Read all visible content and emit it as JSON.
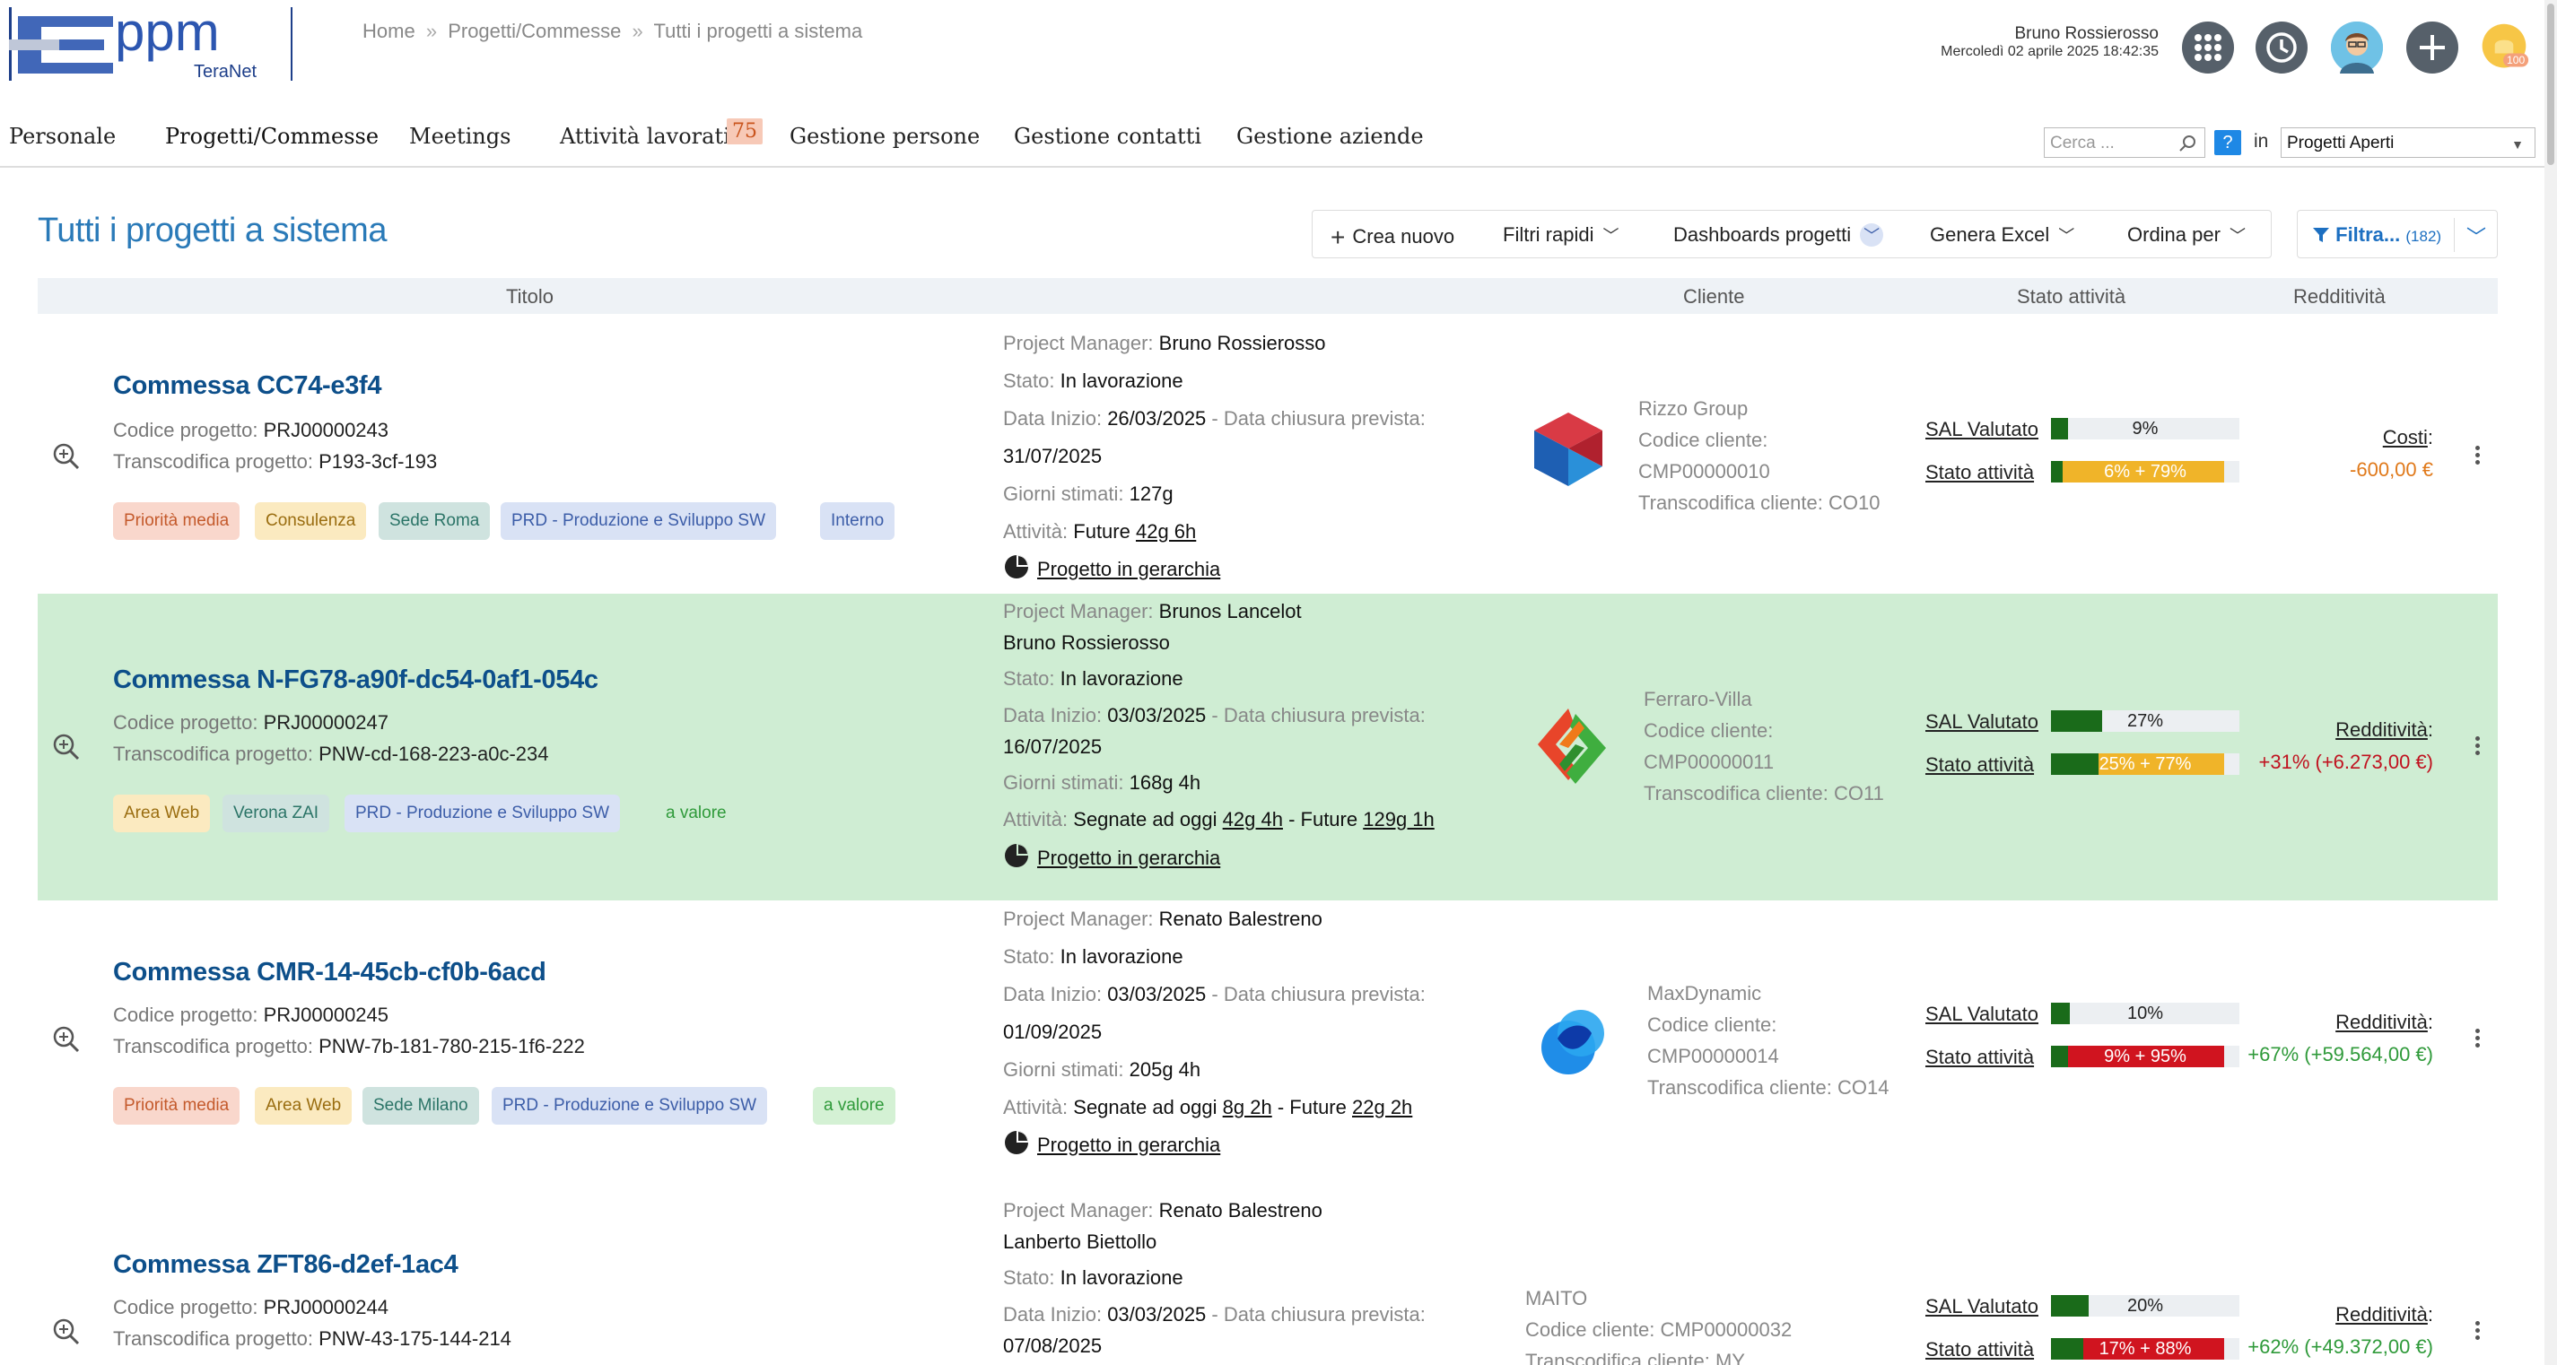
{
  "brand": {
    "name": "ppm",
    "sub": "TeraNet"
  },
  "breadcrumb": {
    "home": "Home",
    "sep1": "»",
    "section": "Progetti/Commesse",
    "sep2": "»",
    "current": "Tutti i progetti a sistema"
  },
  "user": {
    "name": "Bruno Rossierosso",
    "date": "Mercoledì 02 aprile 2025 18:42:35",
    "notifications": "100"
  },
  "nav": {
    "items": [
      "Personale",
      "Progetti/Commesse",
      "Meetings",
      "Attività lavorative",
      "Gestione persone",
      "Gestione contatti",
      "Gestione aziende"
    ],
    "badge": "75",
    "search_placeholder": "Cerca ...",
    "help": "?",
    "in_label": "in",
    "scope_value": "Progetti Aperti"
  },
  "page": {
    "title": "Tutti i progetti a sistema"
  },
  "toolbar": {
    "create": "Crea nuovo",
    "quick_filters": "Filtri rapidi",
    "dashboards": "Dashboards progetti",
    "excel": "Genera Excel",
    "order": "Ordina per",
    "filter": "Filtra...",
    "filter_count": "(182)"
  },
  "table": {
    "col_title": "Titolo",
    "col_client": "Cliente",
    "col_status": "Stato attività",
    "col_profit": "Redditività"
  },
  "labels": {
    "code": "Codice progetto",
    "transcode": "Transcodifica progetto",
    "pm": "Project Manager:",
    "state": "Stato:",
    "start": "Data Inizio:",
    "end": "- Data chiusura prevista:",
    "days": "Giorni stimati:",
    "activities": "Attività:",
    "hierarchy": "Progetto in gerarchia",
    "client_code": "Codice cliente:",
    "client_transcode": "Transcodifica cliente:",
    "sal": "SAL Valutato",
    "stato_att": "Stato attività"
  },
  "rows": [
    {
      "title": "Commessa CC74-e3f4",
      "code": "PRJ00000243",
      "transcode": "P193-3cf-193",
      "tags": [
        "Priorità media",
        "Consulenza",
        "Sede Roma",
        "PRD - Produzione e Sviluppo SW",
        "Interno"
      ],
      "pm": "Bruno Rossierosso",
      "state": "In lavorazione",
      "start": "26/03/2025",
      "end": "31/07/2025",
      "days": "127g",
      "act_prefix": "Future",
      "act_value": "42g 6h",
      "client_name": "Rizzo Group",
      "client_code": "CMP00000010",
      "client_transcode": "CO10",
      "sal": "9%",
      "sal_pct": 0.09,
      "att": "6% + 79%",
      "att_done_pct": 0.06,
      "att_color": "#f0b429",
      "profit_label": "Costi",
      "profit_value": "-600,00 €"
    },
    {
      "title": "Commessa N-FG78-a90f-dc54-0af1-054c",
      "code": "PRJ00000247",
      "transcode": "PNW-cd-168-223-a0c-234",
      "tags": [
        "Area Web",
        "Verona ZAI",
        "PRD - Produzione e Sviluppo SW",
        "a valore"
      ],
      "pm": "Brunos Lancelot",
      "pm2": "Bruno Rossierosso",
      "state": "In lavorazione",
      "start": "03/03/2025",
      "end": "16/07/2025",
      "days": "168g 4h",
      "act_prefix": "Segnate ad oggi",
      "act_value": "42g 4h",
      "act_future_label": "- Future",
      "act_future": "129g 1h",
      "client_name": "Ferraro-Villa",
      "client_code": "CMP00000011",
      "client_transcode": "CO11",
      "sal": "27%",
      "sal_pct": 0.27,
      "att": "25% + 77%",
      "att_done_pct": 0.25,
      "att_color": "#f0b429",
      "profit_label": "Redditività",
      "profit_value": "+31% (+6.273,00 €)"
    },
    {
      "title": "Commessa CMR-14-45cb-cf0b-6acd",
      "code": "PRJ00000245",
      "transcode": "PNW-7b-181-780-215-1f6-222",
      "tags": [
        "Priorità media",
        "Area Web",
        "Sede Milano",
        "PRD - Produzione e Sviluppo SW",
        "a valore"
      ],
      "pm": "Renato Balestreno",
      "state": "In lavorazione",
      "start": "03/03/2025",
      "end": "01/09/2025",
      "days": "205g 4h",
      "act_prefix": "Segnate ad oggi",
      "act_value": "8g 2h",
      "act_future_label": "- Future",
      "act_future": "22g 2h",
      "client_name": "MaxDynamic",
      "client_code": "CMP00000014",
      "client_transcode": "CO14",
      "sal": "10%",
      "sal_pct": 0.1,
      "att": "9% + 95%",
      "att_done_pct": 0.09,
      "att_color": "#d0141f",
      "profit_label": "Redditività",
      "profit_value": "+67% (+59.564,00 €)"
    },
    {
      "title": "Commessa ZFT86-d2ef-1ac4",
      "code": "PRJ00000244",
      "transcode": "PNW-43-175-144-214",
      "pm": "Renato Balestreno",
      "pm2": "Lanberto Biettollo",
      "state": "In lavorazione",
      "start": "03/03/2025",
      "end": "07/08/2025",
      "client_name": "MAITO",
      "client_code": "CMP00000032",
      "client_transcode": "MY",
      "sal": "20%",
      "sal_pct": 0.2,
      "att": "17% + 88%",
      "att_done_pct": 0.17,
      "att_color": "#d0141f",
      "profit_label": "Redditività",
      "profit_value": "+62% (+49.372,00 €)"
    }
  ],
  "colors": {
    "accent": "#2a7ab8",
    "title": "#0d4f8a",
    "row_highlight": "#cfedd3",
    "done": "#1a6b1a"
  }
}
